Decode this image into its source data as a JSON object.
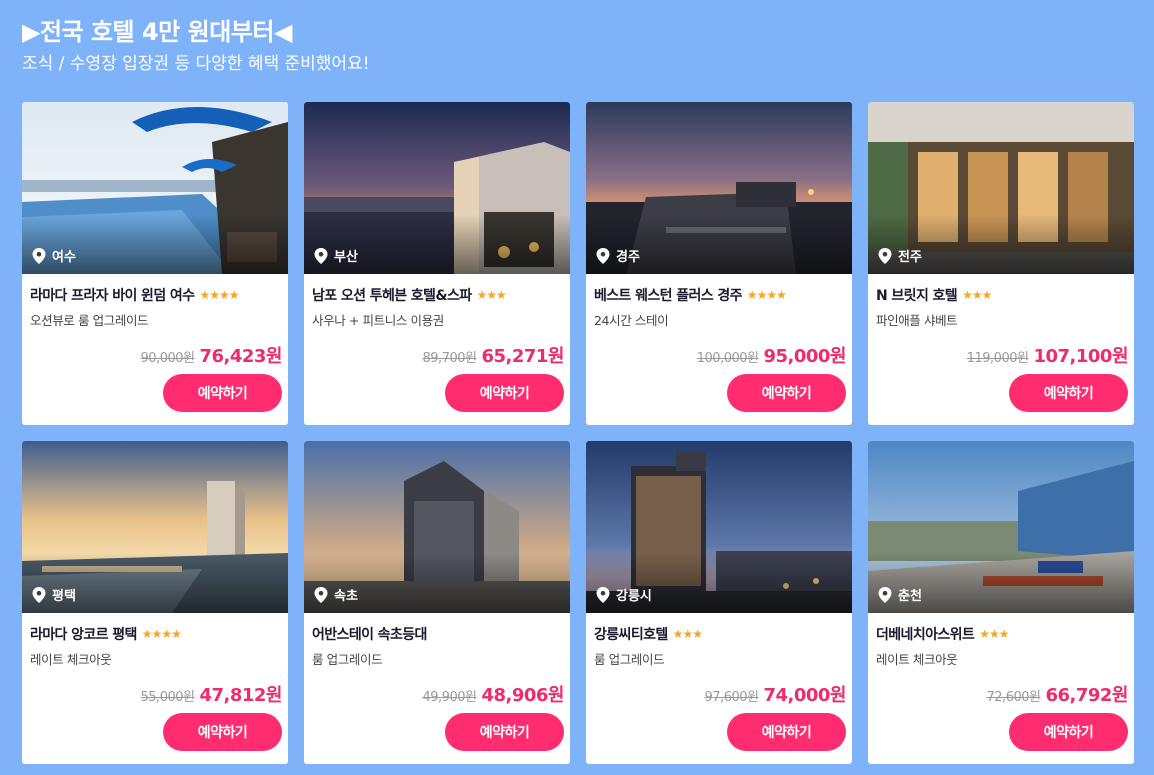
{
  "header": {
    "title": "▶전국 호텔 4만 원대부터◀",
    "subtitle": "조식 / 수영장 입장권 등 다양한 혜택 준비했어요!"
  },
  "colors": {
    "background": "#7fb3f9",
    "accent": "#ff2d6f",
    "sale_price": "#ee2b6c",
    "star": "#f5a623"
  },
  "icons": {
    "location": "map-pin-icon",
    "star": "star-icon"
  },
  "book_label": "예약하기",
  "hotels": [
    {
      "location": "여수",
      "name": "라마다 프라자 바이 윈덤 여수",
      "stars": "★★★★",
      "rating": 4,
      "benefit": "오션뷰로 룸 업그레이드",
      "original_price": "90,000원",
      "sale_price": "76,423원"
    },
    {
      "location": "부산",
      "name": "남포 오션 투헤븐 호텔&스파",
      "stars": "★★★",
      "rating": 3,
      "benefit": "사우나 + 피트니스 이용권",
      "original_price": "89,700원",
      "sale_price": "65,271원"
    },
    {
      "location": "경주",
      "name": "베스트 웨스턴 플러스 경주",
      "stars": "★★★★",
      "rating": 4,
      "benefit": "24시간 스테이",
      "original_price": "100,000원",
      "sale_price": "95,000원"
    },
    {
      "location": "전주",
      "name": "N 브릿지 호텔",
      "stars": "★★★",
      "rating": 3,
      "benefit": "파인애플 샤베트",
      "original_price": "119,000원",
      "sale_price": "107,100원"
    },
    {
      "location": "평택",
      "name": "라마다 앙코르 평택",
      "stars": "★★★★",
      "rating": 4,
      "benefit": "레이트 체크아웃",
      "original_price": "55,000원",
      "sale_price": "47,812원"
    },
    {
      "location": "속초",
      "name": "어반스테이 속초등대",
      "stars": "",
      "rating": 0,
      "benefit": "룸 업그레이드",
      "original_price": "49,900원",
      "sale_price": "48,906원"
    },
    {
      "location": "강릉시",
      "name": "강릉씨티호텔",
      "stars": "★★★",
      "rating": 3,
      "benefit": "룸 업그레이드",
      "original_price": "97,600원",
      "sale_price": "74,000원"
    },
    {
      "location": "춘천",
      "name": "더베네치아스위트",
      "stars": "★★★",
      "rating": 3,
      "benefit": "레이트 체크아웃",
      "original_price": "72,600원",
      "sale_price": "66,792원"
    }
  ]
}
